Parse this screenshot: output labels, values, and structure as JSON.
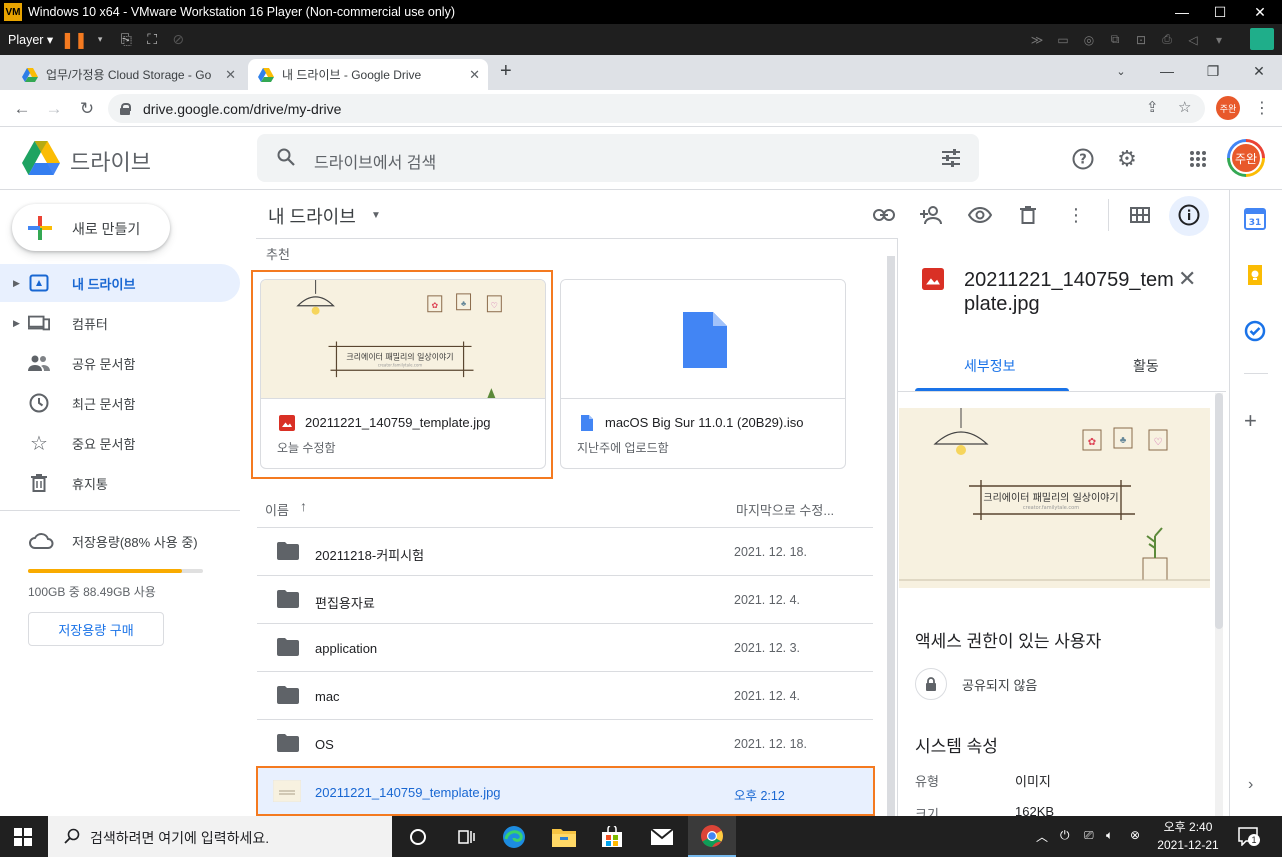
{
  "vm": {
    "title": "Windows 10 x64 - VMware Workstation 16 Player (Non-commercial use only)",
    "player_label": "Player",
    "minimize": "—",
    "maximize": "☐",
    "close": "✕"
  },
  "browser": {
    "tabs": [
      {
        "label": "업무/가정용 Cloud Storage - Go"
      },
      {
        "label": "내 드라이브 - Google Drive"
      }
    ],
    "new_tab": "+",
    "url": "drive.google.com/drive/my-drive",
    "profile_initials": "주완"
  },
  "drive": {
    "app_name": "드라이브",
    "search_placeholder": "드라이브에서 검색",
    "avatar_initials": "주완",
    "new_button": "새로 만들기",
    "nav": [
      {
        "label": "내 드라이브",
        "icon": "my-drive-icon"
      },
      {
        "label": "컴퓨터",
        "icon": "computers-icon"
      },
      {
        "label": "공유 문서함",
        "icon": "shared-icon"
      },
      {
        "label": "최근 문서함",
        "icon": "recent-icon"
      },
      {
        "label": "중요 문서함",
        "icon": "starred-icon"
      },
      {
        "label": "휴지통",
        "icon": "trash-icon"
      }
    ],
    "storage": {
      "label": "저장용량(88% 사용 중)",
      "used_fraction": 0.88,
      "text": "100GB 중 88.49GB 사용",
      "buy_label": "저장용량 구매"
    },
    "main_title": "내 드라이브",
    "suggested_label": "추천",
    "cards": [
      {
        "name": "20211221_140759_template.jpg",
        "sub": "오늘 수정함",
        "type": "image"
      },
      {
        "name": "macOS Big Sur 11.0.1 (20B29).iso",
        "sub": "지난주에 업로드함",
        "type": "file"
      }
    ],
    "thumb_text": "크리에이터 패밀리의 일상이야기",
    "thumb_subtext": "creator.familytale.com",
    "list": {
      "col_name": "이름",
      "col_modified": "마지막으로 수정...",
      "rows": [
        {
          "name": "20211218-커피시험",
          "date": "2021. 12. 18.",
          "type": "folder"
        },
        {
          "name": "편집용자료",
          "date": "2021. 12. 4.",
          "type": "folder"
        },
        {
          "name": "application",
          "date": "2021. 12. 3.",
          "type": "folder"
        },
        {
          "name": "mac",
          "date": "2021. 12. 4.",
          "type": "folder"
        },
        {
          "name": "OS",
          "date": "2021. 12. 18.",
          "type": "folder"
        },
        {
          "name": "20211221_140759_template.jpg",
          "date": "오후 2:12",
          "type": "image"
        }
      ]
    },
    "details": {
      "title": "20211221_140759_template.jpg",
      "tab_details": "세부정보",
      "tab_activity": "활동",
      "access_heading": "액세스 권한이 있는 사용자",
      "not_shared": "공유되지 않음",
      "system_heading": "시스템 속성",
      "props": [
        {
          "label": "유형",
          "value": "이미지"
        },
        {
          "label": "크기",
          "value": "162KB"
        }
      ]
    }
  },
  "taskbar": {
    "search_placeholder": "검색하려면 여기에 입력하세요.",
    "time": "오후 2:40",
    "date": "2021-12-21",
    "notification_count": "1"
  },
  "colors": {
    "accent": "#1a73e8",
    "highlight": "#f47a20",
    "storage": "#f9ab00"
  }
}
